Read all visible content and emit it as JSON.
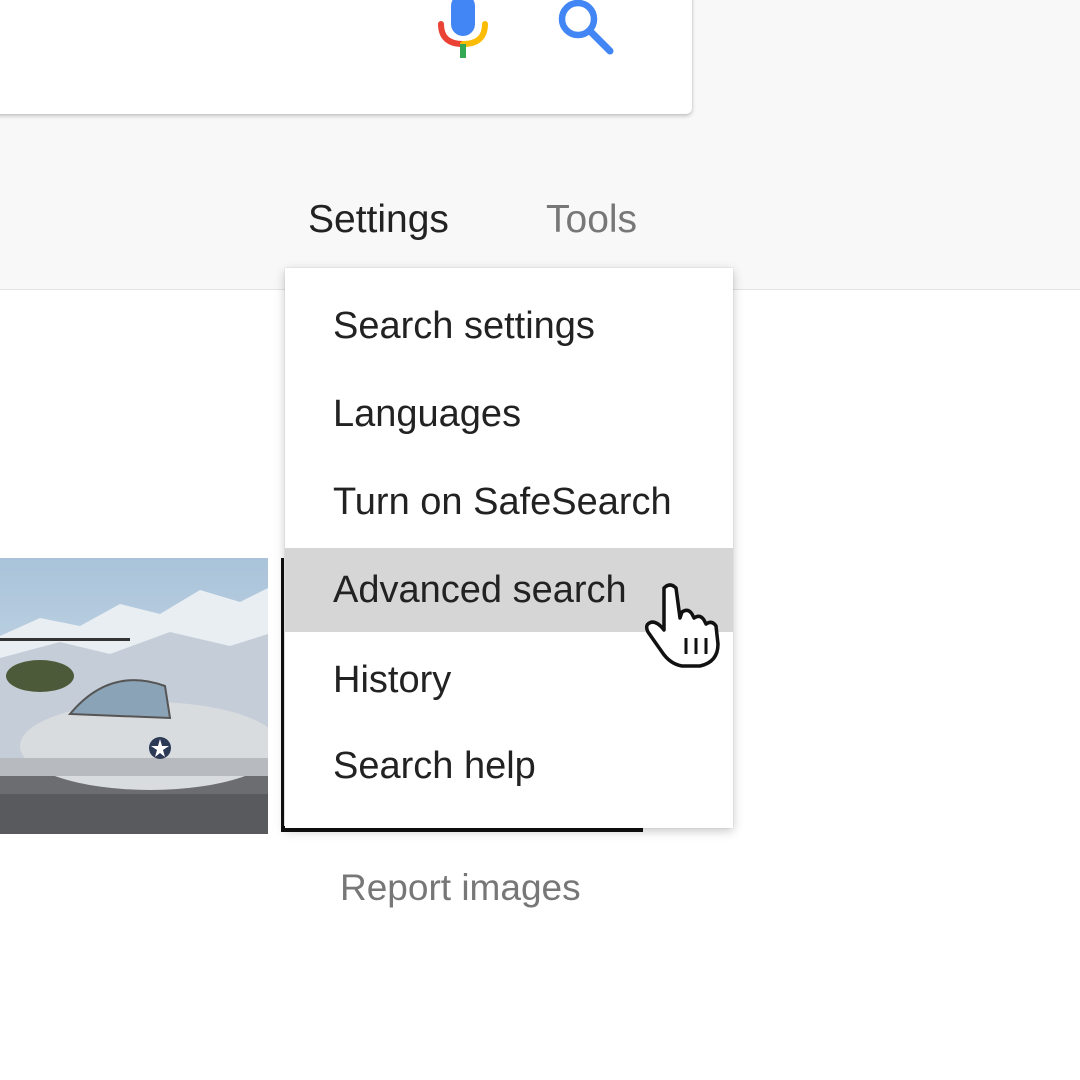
{
  "header": {
    "mic_icon": "mic-icon",
    "search_icon": "search-icon",
    "colors": {
      "blue": "#4285f4",
      "red": "#ea4335",
      "yellow": "#fbbc05",
      "green": "#34a853"
    }
  },
  "nav": {
    "settings_label": "Settings",
    "tools_label": "Tools"
  },
  "settings_menu": {
    "items": [
      {
        "label": "Search settings"
      },
      {
        "label": "Languages"
      },
      {
        "label": "Turn on SafeSearch"
      },
      {
        "label": "Advanced search",
        "highlighted": true
      },
      {
        "label": "History"
      },
      {
        "label": "Search help"
      }
    ]
  },
  "footer": {
    "report_label": "Report images"
  },
  "cursor": {
    "icon": "hand-pointer-icon"
  }
}
